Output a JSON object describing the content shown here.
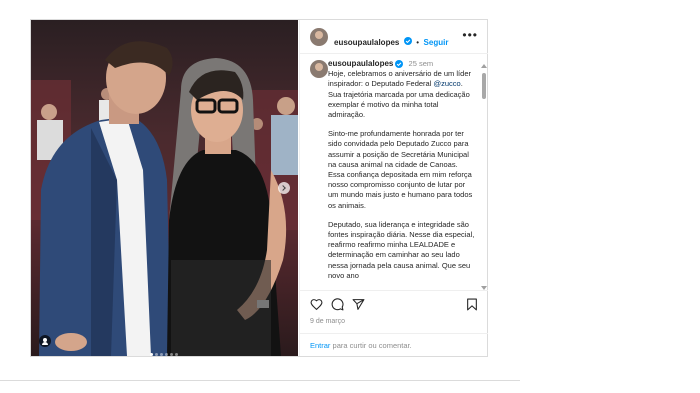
{
  "post": {
    "username": "eusoupaulalopes",
    "follow_label": "Seguir",
    "more_label": "•••",
    "time_ago": "25 sem",
    "caption": {
      "p1_before": "Hoje, celebramos o aniversário de um líder inspirador: o Deputado Federal ",
      "mention": "@zucco",
      "p1_after": ". Sua trajetória marcada por uma dedicação exemplar é motivo da minha total admiração.",
      "p2": "Sinto-me profundamente honrada por ter sido convidada pelo Deputado Zucco para assumir a posição de Secretária Municipal na causa animal na cidade de Canoas. Essa confiança depositada em mim reforça nosso compromisso conjunto de lutar por um mundo mais justo e humano para todos os animais.",
      "p3": "Deputado, sua liderança e integridade são fontes inspiração diária. Nesse dia especial, reafirmo reafirmo minha LEALDADE e determinação em caminhar ao seu lado nessa jornada pela causa animal. Que seu novo ano"
    },
    "date": "9 de março",
    "comment_login": "Entrar",
    "comment_rest": " para curtir ou comentar.",
    "carousel": {
      "slides": 6,
      "active": 1
    },
    "icons": {
      "like": "heart-icon",
      "comment": "comment-icon",
      "share": "share-icon",
      "save": "bookmark-icon",
      "verified": "verified-badge-icon",
      "next": "chevron-right-icon",
      "tag": "user-tag-icon"
    },
    "colors": {
      "link": "#0095f6",
      "mention": "#00376b",
      "muted": "#8e8e8e",
      "text": "#262626"
    }
  }
}
